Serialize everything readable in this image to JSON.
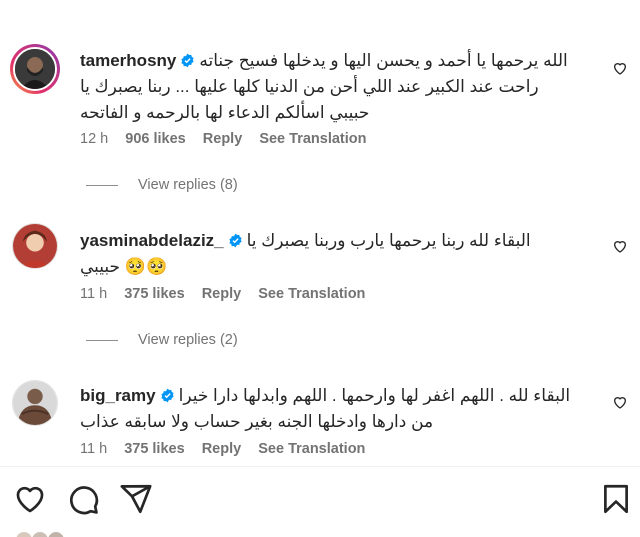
{
  "comments": [
    {
      "username": "tamerhosny",
      "lines": [
        "الله يرحمها يا أحمد و يحسن اليها و يدخلها فسيح جناته",
        "راحت عند الكبير عند اللي أحن من الدنيا كلها عليها ... ربنا يصبرك يا",
        "حبيبي اسألكم الدعاء لها بالرحمه و الفاتحه"
      ],
      "time": "12 h",
      "likes": "906 likes",
      "reply": "Reply",
      "translation": "See Translation",
      "view_replies": "View replies (8)"
    },
    {
      "username": "yasminabdelaziz_",
      "lines": [
        "البقاء لله ربنا يرحمها يارب وربنا يصبرك يا",
        "حبيبي 🥺🥺"
      ],
      "time": "11 h",
      "likes": "375 likes",
      "reply": "Reply",
      "translation": "See Translation",
      "view_replies": "View replies (2)"
    },
    {
      "username": "big_ramy",
      "lines": [
        "البقاء لله . اللهم اغفر لها وارحمها . اللهم وابدلها دارا خيرا",
        "من دارها وادخلها الجنه بغير حساب ولا سابقه عذاب"
      ],
      "time": "11 h",
      "likes": "375 likes",
      "reply": "Reply",
      "translation": "See Translation"
    }
  ],
  "colors": {
    "verified": "#0095f6",
    "muted": "#737373",
    "text": "#262626"
  },
  "icons": [
    "heart-icon",
    "comment-icon",
    "share-icon",
    "bookmark-icon",
    "verified-badge-icon"
  ]
}
